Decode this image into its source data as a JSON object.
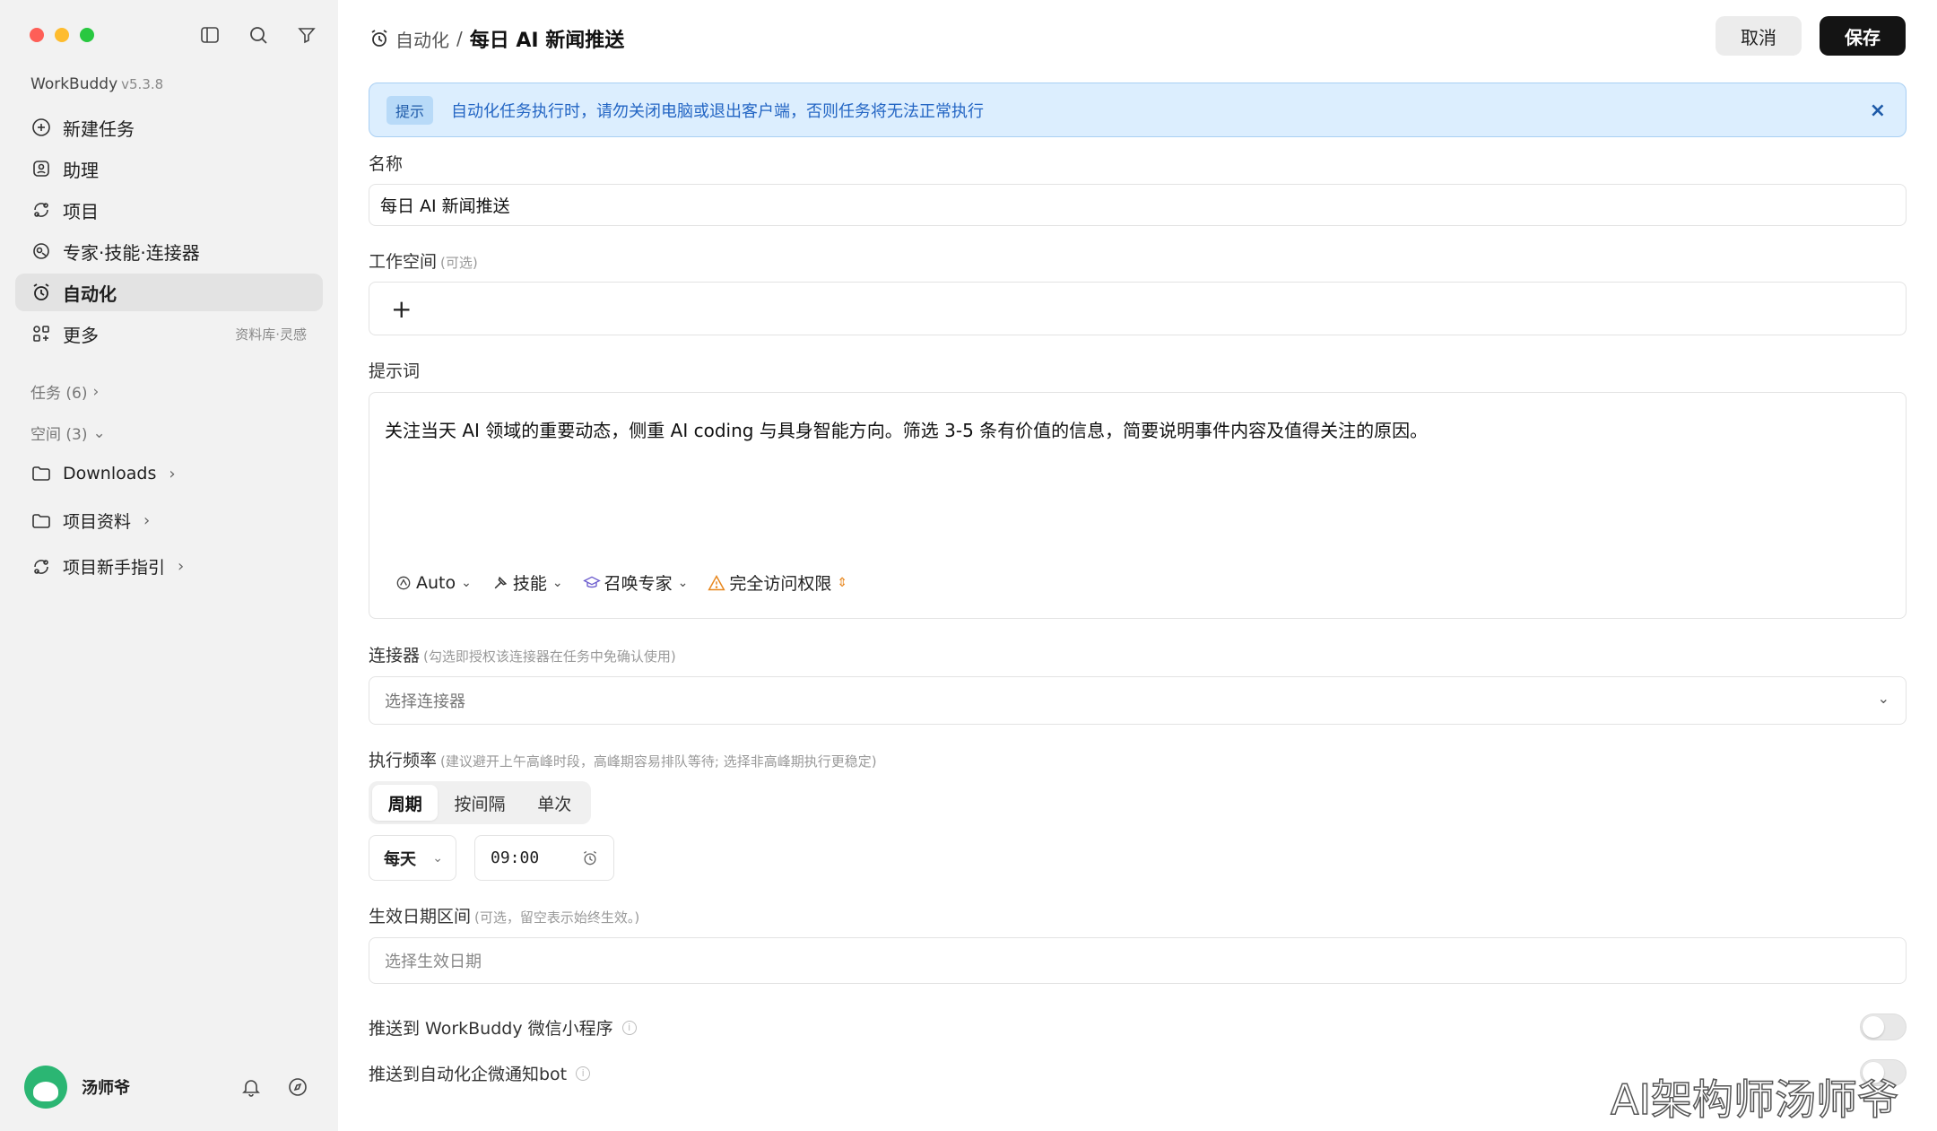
{
  "sidebar": {
    "app_name": "WorkBuddy",
    "version": "v5.3.8",
    "nav": [
      {
        "label": "新建任务",
        "icon": "plus-circle-icon"
      },
      {
        "label": "助理",
        "icon": "assistant-icon"
      },
      {
        "label": "项目",
        "icon": "project-icon"
      },
      {
        "label": "专家·技能·连接器",
        "icon": "expert-icon"
      },
      {
        "label": "自动化",
        "icon": "alarm-clock-icon",
        "active": true
      },
      {
        "label": "更多",
        "icon": "grid-icon",
        "extra": "资料库·灵感"
      }
    ],
    "tasks_group": "任务 (6)",
    "spaces_group": "空间 (3)",
    "folders": [
      {
        "label": "Downloads",
        "icon": "folder-icon"
      },
      {
        "label": "项目资料",
        "icon": "folder-icon"
      },
      {
        "label": "项目新手指引",
        "icon": "project-icon"
      }
    ],
    "user_name": "汤师爷"
  },
  "header": {
    "crumb": "自动化",
    "separator": "/",
    "title": "每日 AI 新闻推送",
    "cancel_label": "取消",
    "save_label": "保存"
  },
  "tip": {
    "badge": "提示",
    "text": "自动化任务执行时，请勿关闭电脑或退出客户端，否则任务将无法正常执行",
    "close": "×"
  },
  "form": {
    "name_label": "名称",
    "name_value": "每日 AI 新闻推送",
    "workspace_label": "工作空间",
    "workspace_hint": "(可选)",
    "workspace_add": "+",
    "prompt_label": "提示词",
    "prompt_value": "关注当天 AI 领域的重要动态，侧重 AI coding 与具身智能方向。筛选 3-5 条有价值的信息，简要说明事件内容及值得关注的原因。",
    "prompt_tools": {
      "model": "Auto",
      "skills": "技能",
      "experts": "召唤专家",
      "access": "完全访问权限"
    },
    "connector_label": "连接器",
    "connector_hint": "(勾选即授权该连接器在任务中免确认使用)",
    "connector_placeholder": "选择连接器",
    "freq_label": "执行频率",
    "freq_hint": "(建议避开上午高峰时段，高峰期容易排队等待; 选择非高峰期执行更稳定)",
    "freq_tabs": [
      "周期",
      "按间隔",
      "单次"
    ],
    "freq_selected": "周期",
    "day_value": "每天",
    "time_value": "09:00",
    "date_label": "生效日期区间",
    "date_hint": "(可选，留空表示始终生效。)",
    "date_placeholder": "选择生效日期",
    "push_wechat_label": "推送到 WorkBuddy 微信小程序",
    "push_wechat_on": false,
    "push_bot_label": "推送到自动化企微通知bot",
    "push_bot_on": false
  },
  "watermark": "AI架构师汤师爷"
}
